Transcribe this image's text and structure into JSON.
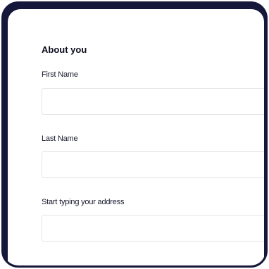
{
  "form": {
    "section_title": "About you",
    "fields": [
      {
        "label": "First Name",
        "value": "",
        "placeholder": ""
      },
      {
        "label": "Last Name",
        "value": "",
        "placeholder": ""
      },
      {
        "label": "Start typing your address",
        "value": "",
        "placeholder": ""
      }
    ]
  },
  "colors": {
    "frame": "#15183a",
    "input_border": "#e3e3e3",
    "text": "#0b0c1d"
  }
}
